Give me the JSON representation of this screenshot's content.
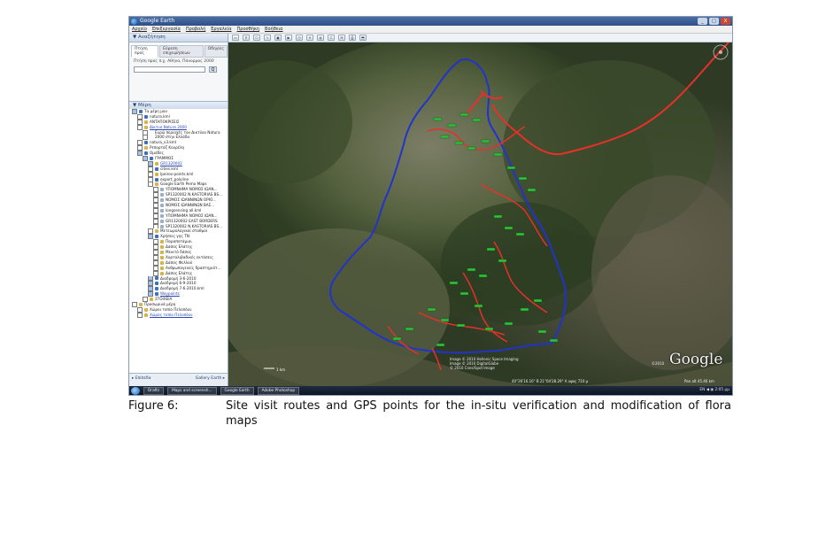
{
  "window": {
    "title": "Google Earth",
    "controls": [
      "_",
      "□",
      "X"
    ]
  },
  "menu": [
    "Αρχείο",
    "Επεξεργασία",
    "Προβολή",
    "Εργαλεία",
    "Προσθήκη",
    "Βοήθεια"
  ],
  "sidebar": {
    "search_header": "▼ Αναζήτηση",
    "search_tabs": [
      "Πτήση προς",
      "Εύρεση επιχειρήσεων",
      "Οδηγίες"
    ],
    "search_label": "Πτήση προς π.χ. Αθήνα, Πάνορμος 2000",
    "search_placeholder": "",
    "search_button": "Q",
    "places_header": "▼ Μέρη",
    "tree": [
      {
        "label": "Τα μέρη μου",
        "indent": 0,
        "checked": true,
        "color": "#3a6fc4"
      },
      {
        "label": "natura.kml",
        "indent": 1,
        "checked": false,
        "color": "#3a6fc4"
      },
      {
        "label": "ΑΝΤΑΠΟΚΡΙΣΕΙΣ",
        "indent": 1,
        "checked": false,
        "color": "#d9b441"
      },
      {
        "label": "Δίκτυο Natura 2000",
        "indent": 1,
        "checked": false,
        "color": "#d9b441",
        "link": true
      },
      {
        "label": "Ευρώ περιοχές του Δικτύου Natura",
        "indent": 2,
        "checked": false,
        "color": "#ffffff"
      },
      {
        "label": "2000 στην Ελλάδα",
        "indent": 2,
        "checked": false,
        "color": "#ffffff"
      },
      {
        "label": "natura_v3.kml",
        "indent": 1,
        "checked": false,
        "color": "#3a6fc4"
      },
      {
        "label": "Ρεπορτάζ Κουρέλη",
        "indent": 1,
        "checked": false,
        "color": "#d9b441"
      },
      {
        "label": "Ομάδες",
        "indent": 1,
        "checked": true,
        "color": "#3a6fc4"
      },
      {
        "label": "ΓΡΑΜΜΟΣ",
        "indent": 2,
        "checked": true,
        "color": "#3a6fc4"
      },
      {
        "label": "GR1320002",
        "indent": 3,
        "checked": true,
        "color": "#d9b441",
        "link": true
      },
      {
        "label": "cities.kml",
        "indent": 3,
        "checked": false,
        "color": "#3a6fc4"
      },
      {
        "label": "Ipeiros-points.kml",
        "indent": 3,
        "checked": false,
        "color": "#d9b441"
      },
      {
        "label": "export_polyline",
        "indent": 3,
        "checked": false,
        "color": "#3a6fc4"
      },
      {
        "label": "Google Earth Pemo Maps",
        "indent": 3,
        "checked": false,
        "color": "#d9b441"
      },
      {
        "label": "ΥΠΟΜΝΗΜΑ ΝΟΜΟΣ ΙΩΑΝ...",
        "indent": 4,
        "checked": false,
        "color": "#9bb0c8"
      },
      {
        "label": "SP1320002 N.KASTORIAS BS...",
        "indent": 4,
        "checked": false,
        "color": "#9bb0c8"
      },
      {
        "label": "ΝΟΜΟΣ ΙΩΑΝΝΙΝΩΝ ΟΡΙΟ...",
        "indent": 4,
        "checked": false,
        "color": "#9bb0c8"
      },
      {
        "label": "ΝΟΜΟΣ ΙΩΑΝΝΙΝΩΝ ΒΑΣ...",
        "indent": 4,
        "checked": false,
        "color": "#9bb0c8"
      },
      {
        "label": "longsensing all.kml",
        "indent": 4,
        "checked": false,
        "color": "#9bb0c8"
      },
      {
        "label": "ΥΠΟΜΝΗΜΑ ΝΟΜΟΣ ΙΩΑΝ...",
        "indent": 4,
        "checked": false,
        "color": "#9bb0c8"
      },
      {
        "label": "GR1320002 EAST BORDERS",
        "indent": 4,
        "checked": false,
        "color": "#9bb0c8"
      },
      {
        "label": "SP1320002 N.KASTORIAS BS...",
        "indent": 4,
        "checked": false,
        "color": "#9bb0c8"
      },
      {
        "label": "Μετεωρολογικοί σταθμοί",
        "indent": 3,
        "checked": false,
        "color": "#d9b441"
      },
      {
        "label": "Χρήσεις γης ΤΝ",
        "indent": 3,
        "checked": true,
        "color": "#3a6fc4"
      },
      {
        "label": "Παραποτάμιοι",
        "indent": 4,
        "checked": false,
        "color": "#d9b441"
      },
      {
        "label": "Δάσος Ελάτης",
        "indent": 4,
        "checked": false,
        "color": "#d9b441"
      },
      {
        "label": "Μεικτό δάσος",
        "indent": 4,
        "checked": false,
        "color": "#d9b441"
      },
      {
        "label": "Χορτολιβαδικές εκτάσεις",
        "indent": 4,
        "checked": false,
        "color": "#d9b441"
      },
      {
        "label": "Δάσος Φελλού",
        "indent": 4,
        "checked": false,
        "color": "#d9b441"
      },
      {
        "label": "Ανθρωπογενείς δραστηριότ...",
        "indent": 4,
        "checked": false,
        "color": "#d9b441"
      },
      {
        "label": "Δάσος Ελάτης",
        "indent": 4,
        "checked": false,
        "color": "#d9b441"
      },
      {
        "label": "Διαδρομή 3-6-2010",
        "indent": 3,
        "checked": true,
        "color": "#3a6fc4"
      },
      {
        "label": "Διαδρομή 6-9-2010",
        "indent": 3,
        "checked": true,
        "color": "#3a6fc4"
      },
      {
        "label": "Διαδρομή 7-6-2010.kml",
        "indent": 3,
        "checked": true,
        "color": "#3a6fc4"
      },
      {
        "label": "Waypoints",
        "indent": 3,
        "checked": true,
        "color": "#3a6fc4",
        "link": true
      },
      {
        "label": "ΣΤΟΙΧΕΙΑ",
        "indent": 2,
        "checked": false,
        "color": "#d9b441"
      },
      {
        "label": "Προσωρινά μέρη",
        "indent": 0,
        "checked": false,
        "color": "#d9b441"
      },
      {
        "label": "Χώροι τοπίο Πελοπόνν",
        "indent": 1,
        "checked": false,
        "color": "#d9b441"
      },
      {
        "label": "Χώρος τοπίο Πελοπόνν",
        "indent": 1,
        "checked": false,
        "color": "#d9b441",
        "link": true
      }
    ],
    "bottom_left": "▸ Επίπεδα",
    "bottom_right": "Gallery Earth ▸"
  },
  "toolbar_icons": [
    "layout-icon",
    "placemark-icon",
    "polygon-icon",
    "path-icon",
    "overlay-icon",
    "tour-icon",
    "history-icon",
    "sun-icon",
    "planet-icon",
    "ruler-icon",
    "email-icon",
    "print-icon",
    "kml-icon"
  ],
  "map": {
    "attribution": [
      "Image © 2010 Hellenic Space Imaging",
      "Image © 2010 DigitalGlobe",
      "© 2010 Cnes/Spot Image"
    ],
    "logo": "Google",
    "copyright": "©2010",
    "coords": "40°26'16.16\" B  21°04'28.29\" A   υψος 710 μ",
    "eye_alt": "Pan alt 45.46 km",
    "scale": "1 km",
    "colors": {
      "route_blue": "#2233cc",
      "route_red": "#e8302a",
      "waypoint": "#2fbf3a"
    }
  },
  "taskbar": {
    "items": [
      "Drafts",
      "Maps and screensh...",
      "Google Earth",
      "Adobe Photoshop"
    ],
    "tray": "EN  ◀  ◉  2:05 μμ"
  },
  "caption": {
    "label": "Figure 6:",
    "text": "Site visit routes and GPS points for the in-situ verification and modification of flora maps"
  }
}
